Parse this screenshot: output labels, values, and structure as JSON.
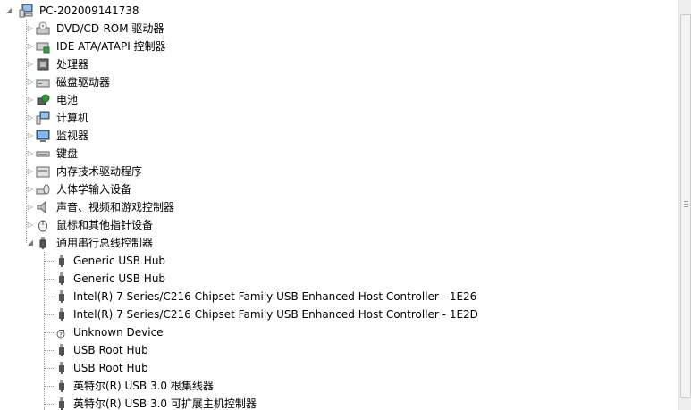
{
  "tree": {
    "root": {
      "label": "PC-202009141738",
      "icon": "computer-icon"
    },
    "categories": [
      {
        "label": "DVD/CD-ROM 驱动器",
        "icon": "dvd-drive-icon"
      },
      {
        "label": "IDE ATA/ATAPI 控制器",
        "icon": "ide-controller-icon"
      },
      {
        "label": "处理器",
        "icon": "processor-icon"
      },
      {
        "label": "磁盘驱动器",
        "icon": "disk-drive-icon"
      },
      {
        "label": "电池",
        "icon": "battery-icon"
      },
      {
        "label": "计算机",
        "icon": "computer-icon"
      },
      {
        "label": "监视器",
        "icon": "monitor-icon"
      },
      {
        "label": "键盘",
        "icon": "keyboard-icon"
      },
      {
        "label": "内存技术驱动程序",
        "icon": "memory-tech-icon"
      },
      {
        "label": "人体学输入设备",
        "icon": "hid-icon"
      },
      {
        "label": "声音、视频和游戏控制器",
        "icon": "speaker-icon"
      },
      {
        "label": "鼠标和其他指针设备",
        "icon": "mouse-icon"
      }
    ],
    "usb": {
      "label": "通用串行总线控制器",
      "icon": "usb-icon",
      "children": [
        {
          "label": "Generic USB Hub",
          "icon": "usb-plug-icon"
        },
        {
          "label": "Generic USB Hub",
          "icon": "usb-plug-icon"
        },
        {
          "label": "Intel(R) 7 Series/C216 Chipset Family USB Enhanced Host Controller - 1E26",
          "icon": "usb-plug-icon"
        },
        {
          "label": "Intel(R) 7 Series/C216 Chipset Family USB Enhanced Host Controller - 1E2D",
          "icon": "usb-plug-icon"
        },
        {
          "label": "Unknown Device",
          "icon": "unknown-device-icon"
        },
        {
          "label": "USB Root Hub",
          "icon": "usb-plug-icon"
        },
        {
          "label": "USB Root Hub",
          "icon": "usb-plug-icon"
        },
        {
          "label": "英特尔(R) USB 3.0 根集线器",
          "icon": "usb-plug-icon"
        },
        {
          "label": "英特尔(R) USB 3.0 可扩展主机控制器",
          "icon": "usb-plug-icon"
        }
      ]
    }
  }
}
